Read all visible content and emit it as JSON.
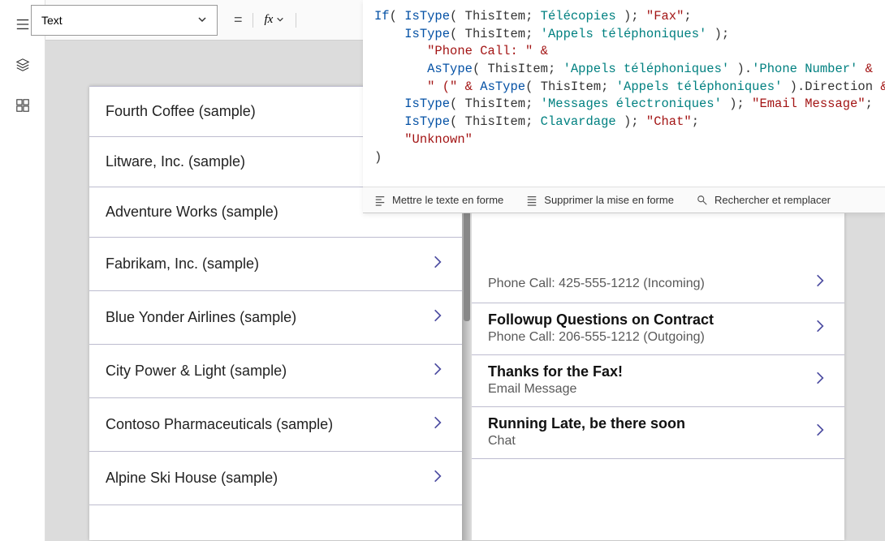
{
  "propertyDropdown": {
    "label": "Text"
  },
  "equals": "=",
  "fx": "fx",
  "formula": {
    "lines": [
      [
        {
          "t": "If",
          "c": "tok-fn"
        },
        {
          "t": "( ",
          "c": "tok-default"
        },
        {
          "t": "IsType",
          "c": "tok-fn"
        },
        {
          "t": "( ",
          "c": "tok-default"
        },
        {
          "t": "ThisItem",
          "c": "tok-default"
        },
        {
          "t": "; ",
          "c": "tok-default"
        },
        {
          "t": "Télécopies",
          "c": "tok-id"
        },
        {
          "t": " ); ",
          "c": "tok-default"
        },
        {
          "t": "\"Fax\"",
          "c": "tok-str"
        },
        {
          "t": ";",
          "c": "tok-default"
        }
      ],
      [
        {
          "t": "    ",
          "c": "tok-default"
        },
        {
          "t": "IsType",
          "c": "tok-fn"
        },
        {
          "t": "( ",
          "c": "tok-default"
        },
        {
          "t": "ThisItem",
          "c": "tok-default"
        },
        {
          "t": "; ",
          "c": "tok-default"
        },
        {
          "t": "'Appels téléphoniques'",
          "c": "tok-id"
        },
        {
          "t": " );",
          "c": "tok-default"
        }
      ],
      [
        {
          "t": "       ",
          "c": "tok-default"
        },
        {
          "t": "\"Phone Call: \"",
          "c": "tok-str"
        },
        {
          "t": " ",
          "c": "tok-default"
        },
        {
          "t": "&",
          "c": "tok-op"
        }
      ],
      [
        {
          "t": "       ",
          "c": "tok-default"
        },
        {
          "t": "AsType",
          "c": "tok-fn"
        },
        {
          "t": "( ",
          "c": "tok-default"
        },
        {
          "t": "ThisItem",
          "c": "tok-default"
        },
        {
          "t": "; ",
          "c": "tok-default"
        },
        {
          "t": "'Appels téléphoniques'",
          "c": "tok-id"
        },
        {
          "t": " ).",
          "c": "tok-default"
        },
        {
          "t": "'Phone Number'",
          "c": "tok-id"
        },
        {
          "t": " ",
          "c": "tok-default"
        },
        {
          "t": "&",
          "c": "tok-op"
        }
      ],
      [
        {
          "t": "       ",
          "c": "tok-default"
        },
        {
          "t": "\" (\"",
          "c": "tok-str"
        },
        {
          "t": " ",
          "c": "tok-default"
        },
        {
          "t": "&",
          "c": "tok-op"
        },
        {
          "t": " ",
          "c": "tok-default"
        },
        {
          "t": "AsType",
          "c": "tok-fn"
        },
        {
          "t": "( ",
          "c": "tok-default"
        },
        {
          "t": "ThisItem",
          "c": "tok-default"
        },
        {
          "t": "; ",
          "c": "tok-default"
        },
        {
          "t": "'Appels téléphoniques'",
          "c": "tok-id"
        },
        {
          "t": " ).",
          "c": "tok-default"
        },
        {
          "t": "Direction",
          "c": "tok-default"
        },
        {
          "t": " ",
          "c": "tok-default"
        },
        {
          "t": "&",
          "c": "tok-op"
        },
        {
          "t": " ",
          "c": "tok-default"
        },
        {
          "t": "\")\"",
          "c": "tok-str"
        },
        {
          "t": ";",
          "c": "tok-default"
        }
      ],
      [
        {
          "t": "    ",
          "c": "tok-default"
        },
        {
          "t": "IsType",
          "c": "tok-fn"
        },
        {
          "t": "( ",
          "c": "tok-default"
        },
        {
          "t": "ThisItem",
          "c": "tok-default"
        },
        {
          "t": "; ",
          "c": "tok-default"
        },
        {
          "t": "'Messages électroniques'",
          "c": "tok-id"
        },
        {
          "t": " ); ",
          "c": "tok-default"
        },
        {
          "t": "\"Email Message\"",
          "c": "tok-str"
        },
        {
          "t": ";",
          "c": "tok-default"
        }
      ],
      [
        {
          "t": "    ",
          "c": "tok-default"
        },
        {
          "t": "IsType",
          "c": "tok-fn"
        },
        {
          "t": "( ",
          "c": "tok-default"
        },
        {
          "t": "ThisItem",
          "c": "tok-default"
        },
        {
          "t": "; ",
          "c": "tok-default"
        },
        {
          "t": "Clavardage",
          "c": "tok-id"
        },
        {
          "t": " ); ",
          "c": "tok-default"
        },
        {
          "t": "\"Chat\"",
          "c": "tok-str"
        },
        {
          "t": ";",
          "c": "tok-default"
        }
      ],
      [
        {
          "t": "    ",
          "c": "tok-default"
        },
        {
          "t": "\"Unknown\"",
          "c": "tok-str"
        }
      ],
      [
        {
          "t": ")",
          "c": "tok-default"
        }
      ]
    ]
  },
  "formulaToolbar": {
    "format": "Mettre le texte en forme",
    "removeFormat": "Supprimer la mise en forme",
    "findReplace": "Rechercher et remplacer"
  },
  "leftList": [
    "Fourth Coffee (sample)",
    "Litware, Inc. (sample)",
    "Adventure Works (sample)",
    "Fabrikam, Inc. (sample)",
    "Blue Yonder Airlines (sample)",
    "City Power & Light (sample)",
    "Contoso Pharmaceuticals (sample)",
    "Alpine Ski House (sample)"
  ],
  "rightList": [
    {
      "title": "",
      "subtitle": "Phone Call: 425-555-1212 (Incoming)"
    },
    {
      "title": "Followup Questions on Contract",
      "subtitle": "Phone Call: 206-555-1212 (Outgoing)"
    },
    {
      "title": "Thanks for the Fax!",
      "subtitle": "Email Message"
    },
    {
      "title": "Running Late, be there soon",
      "subtitle": "Chat"
    }
  ]
}
